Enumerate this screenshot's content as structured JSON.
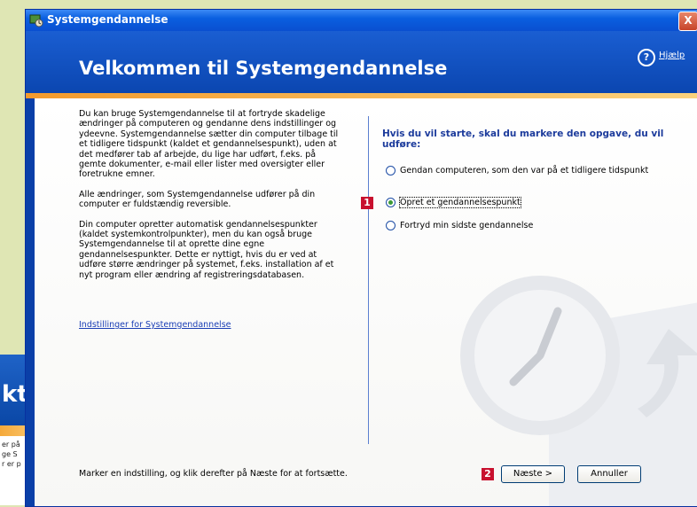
{
  "window": {
    "title": "Systemgendannelse",
    "close_label": "X"
  },
  "header": {
    "heading": "Velkommen til Systemgendannelse",
    "help_label": "Hjælp"
  },
  "left_column": {
    "paragraphs": [
      "Du kan bruge Systemgendannelse til at fortryde skadelige ændringer på computeren og gendanne dens indstillinger og ydeevne. Systemgendannelse sætter din computer tilbage til et tidligere tidspunkt (kaldet et gendannelsespunkt), uden at det medfører tab af arbejde, du lige har udført, f.eks. på gemte dokumenter, e-mail eller lister med oversigter eller foretrukne emner.",
      "Alle ændringer, som Systemgendannelse udfører på din computer er fuldstændig reversible.",
      "Din computer opretter automatisk gendannelsespunkter (kaldet systemkontrolpunkter), men du kan også bruge Systemgendannelse til at oprette dine egne gendannelsespunkter. Dette er nyttigt, hvis du er ved at udføre større ændringer på systemet, f.eks. installation af et nyt program eller ændring af registreringsdatabasen."
    ],
    "settings_link": "Indstillinger for Systemgendannelse"
  },
  "right_column": {
    "prompt": "Hvis du vil starte, skal du markere den opgave, du vil udføre:",
    "options": [
      {
        "label": "Gendan computeren, som den var på et tidligere tidspunkt",
        "selected": false
      },
      {
        "label": "Opret et gendannelsespunkt",
        "selected": true
      },
      {
        "label": "Fortryd min sidste gendannelse",
        "selected": false
      }
    ]
  },
  "footer": {
    "instruction": "Marker en indstilling, og klik derefter på Næste for at fortsætte.",
    "next_label": "Næste >",
    "cancel_label": "Annuller"
  },
  "badges": [
    "1",
    "2"
  ],
  "background_window": {
    "title_fragment": "kt",
    "text_fragments": [
      "er på",
      "ge S",
      "r er p"
    ]
  },
  "colors": {
    "header_blue": "#0b46b0",
    "accent_orange": "#f39a2c",
    "badge_red": "#c8102e",
    "prompt_blue": "#1c3b9c"
  }
}
